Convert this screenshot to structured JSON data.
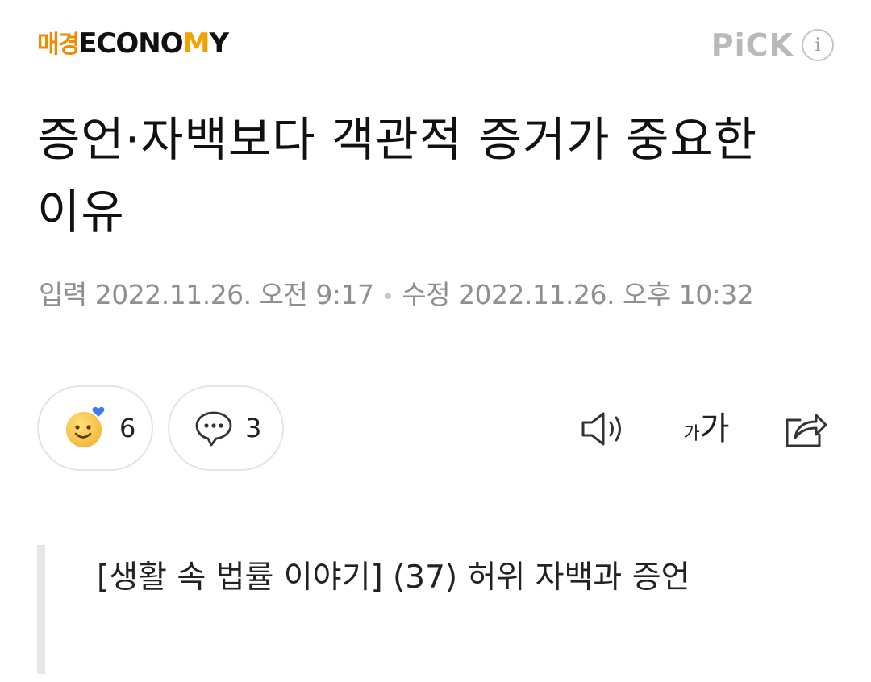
{
  "header": {
    "brand_kr": "매경",
    "brand_en_1": "ECONO",
    "brand_en_2": "M",
    "brand_en_3": "Y",
    "pick_label": "PiCK",
    "info_glyph": "i"
  },
  "article": {
    "title": "증언·자백보다 객관적 증거가 중요한 이유",
    "input_label": "입력",
    "input_datetime": "2022.11.26. 오전 9:17",
    "separator": "•",
    "modified_label": "수정",
    "modified_datetime": "2022.11.26. 오후 10:32",
    "subtitle": "[생활 속 법률 이야기] (37) 허위 자백과 증언"
  },
  "reactions": {
    "like_count": "6",
    "comment_count": "3"
  },
  "tools": {
    "audio_icon": "speaker-icon",
    "font_small": "가",
    "font_large": "가",
    "share_icon": "share-icon"
  },
  "colors": {
    "brand_orange": "#f08a00",
    "brand_yellow": "#f4a000",
    "pick_gray": "#b9b9b9",
    "meta_gray": "#8f8f8f",
    "quote_bar": "#e6e6e6"
  }
}
